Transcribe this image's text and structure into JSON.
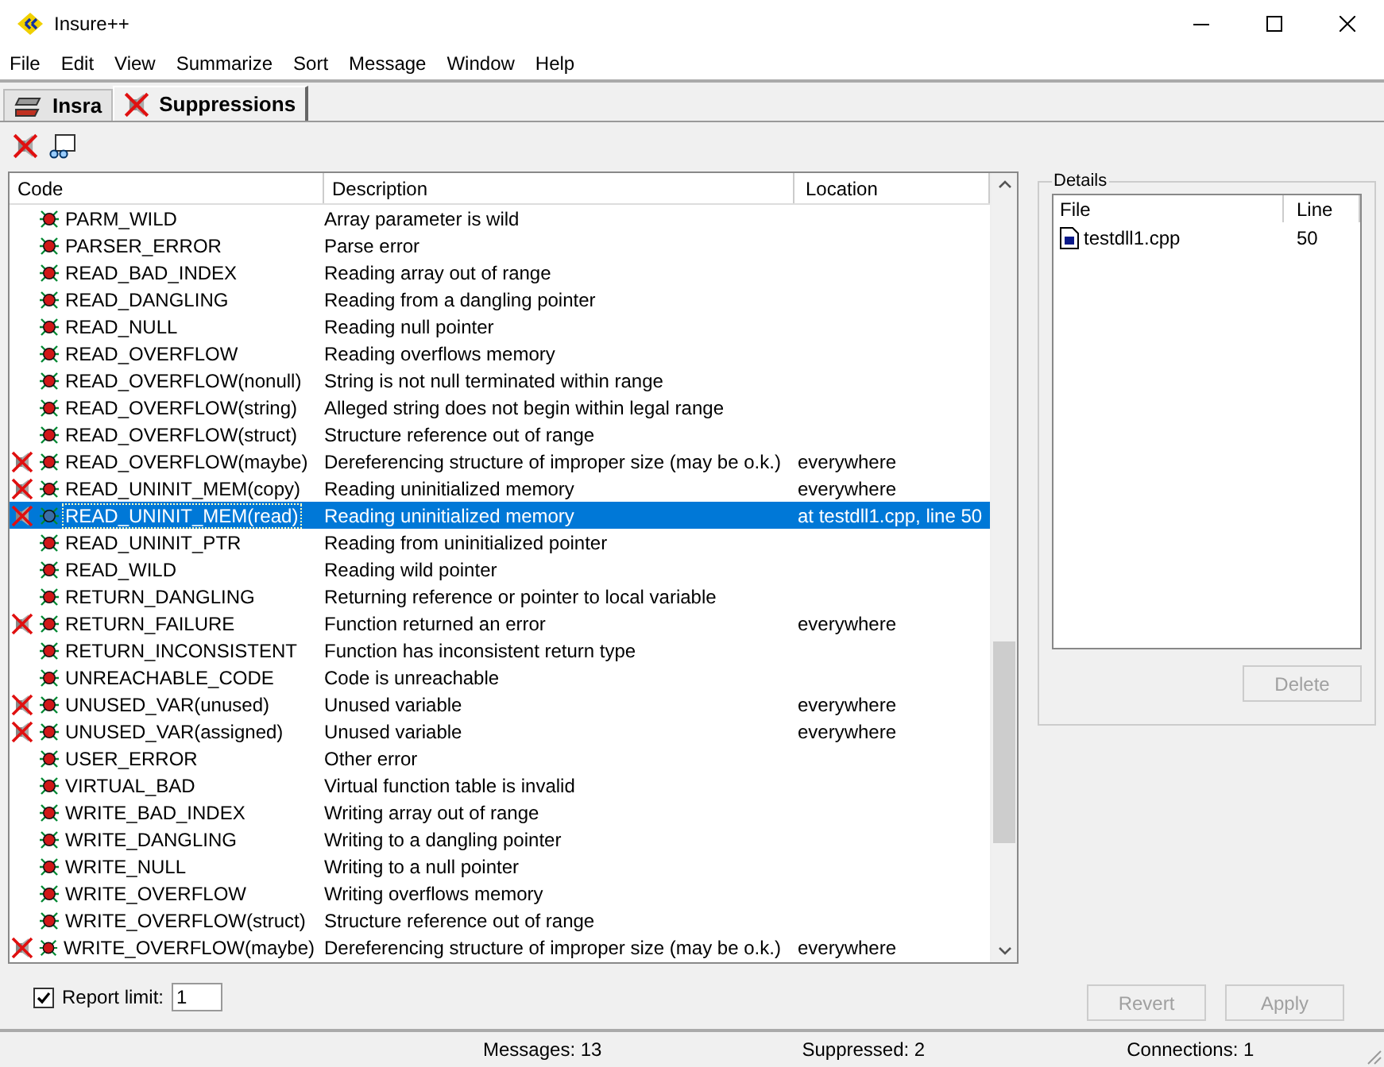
{
  "window": {
    "title": "Insure++"
  },
  "menu": [
    "File",
    "Edit",
    "View",
    "Summarize",
    "Sort",
    "Message",
    "Window",
    "Help"
  ],
  "tabs": [
    {
      "label": "Insra",
      "selected": false
    },
    {
      "label": "Suppressions",
      "selected": true
    }
  ],
  "table": {
    "columns": [
      "Code",
      "Description",
      "Location"
    ],
    "rows": [
      {
        "code": "PARM_WILD",
        "description": "Array parameter is wild",
        "location": "",
        "suppressed": false,
        "selected": false
      },
      {
        "code": "PARSER_ERROR",
        "description": "Parse error",
        "location": "",
        "suppressed": false,
        "selected": false
      },
      {
        "code": "READ_BAD_INDEX",
        "description": "Reading array out of range",
        "location": "",
        "suppressed": false,
        "selected": false
      },
      {
        "code": "READ_DANGLING",
        "description": "Reading from a dangling pointer",
        "location": "",
        "suppressed": false,
        "selected": false
      },
      {
        "code": "READ_NULL",
        "description": "Reading null pointer",
        "location": "",
        "suppressed": false,
        "selected": false
      },
      {
        "code": "READ_OVERFLOW",
        "description": "Reading overflows memory",
        "location": "",
        "suppressed": false,
        "selected": false
      },
      {
        "code": "READ_OVERFLOW(nonull)",
        "description": "String is not null terminated within range",
        "location": "",
        "suppressed": false,
        "selected": false
      },
      {
        "code": "READ_OVERFLOW(string)",
        "description": "Alleged string does not begin within legal range",
        "location": "",
        "suppressed": false,
        "selected": false
      },
      {
        "code": "READ_OVERFLOW(struct)",
        "description": "Structure reference out of range",
        "location": "",
        "suppressed": false,
        "selected": false
      },
      {
        "code": "READ_OVERFLOW(maybe)",
        "description": "Dereferencing structure of improper size (may be o.k.)",
        "location": "everywhere",
        "suppressed": true,
        "selected": false
      },
      {
        "code": "READ_UNINIT_MEM(copy)",
        "description": "Reading uninitialized memory",
        "location": "everywhere",
        "suppressed": true,
        "selected": false
      },
      {
        "code": "READ_UNINIT_MEM(read)",
        "description": "Reading uninitialized memory",
        "location": "at testdll1.cpp, line 50",
        "suppressed": true,
        "selected": true
      },
      {
        "code": "READ_UNINIT_PTR",
        "description": "Reading from uninitialized pointer",
        "location": "",
        "suppressed": false,
        "selected": false
      },
      {
        "code": "READ_WILD",
        "description": "Reading wild pointer",
        "location": "",
        "suppressed": false,
        "selected": false
      },
      {
        "code": "RETURN_DANGLING",
        "description": "Returning reference or pointer to local variable",
        "location": "",
        "suppressed": false,
        "selected": false
      },
      {
        "code": "RETURN_FAILURE",
        "description": "Function returned an error",
        "location": "everywhere",
        "suppressed": true,
        "selected": false
      },
      {
        "code": "RETURN_INCONSISTENT",
        "description": "Function has inconsistent return type",
        "location": "",
        "suppressed": false,
        "selected": false
      },
      {
        "code": "UNREACHABLE_CODE",
        "description": "Code is unreachable",
        "location": "",
        "suppressed": false,
        "selected": false
      },
      {
        "code": "UNUSED_VAR(unused)",
        "description": "Unused variable",
        "location": "everywhere",
        "suppressed": true,
        "selected": false
      },
      {
        "code": "UNUSED_VAR(assigned)",
        "description": "Unused variable",
        "location": "everywhere",
        "suppressed": true,
        "selected": false
      },
      {
        "code": "USER_ERROR",
        "description": "Other error",
        "location": "",
        "suppressed": false,
        "selected": false
      },
      {
        "code": "VIRTUAL_BAD",
        "description": "Virtual function table is invalid",
        "location": "",
        "suppressed": false,
        "selected": false
      },
      {
        "code": "WRITE_BAD_INDEX",
        "description": "Writing array out of range",
        "location": "",
        "suppressed": false,
        "selected": false
      },
      {
        "code": "WRITE_DANGLING",
        "description": "Writing to a dangling pointer",
        "location": "",
        "suppressed": false,
        "selected": false
      },
      {
        "code": "WRITE_NULL",
        "description": "Writing to a null pointer",
        "location": "",
        "suppressed": false,
        "selected": false
      },
      {
        "code": "WRITE_OVERFLOW",
        "description": "Writing overflows memory",
        "location": "",
        "suppressed": false,
        "selected": false
      },
      {
        "code": "WRITE_OVERFLOW(struct)",
        "description": "Structure reference out of range",
        "location": "",
        "suppressed": false,
        "selected": false
      },
      {
        "code": "WRITE_OVERFLOW(maybe)",
        "description": "Dereferencing structure of improper size (may be o.k.)",
        "location": "everywhere",
        "suppressed": true,
        "selected": false
      }
    ]
  },
  "details": {
    "title": "Details",
    "columns": [
      "File",
      "Line"
    ],
    "rows": [
      {
        "file": "testdll1.cpp",
        "line": "50"
      }
    ],
    "delete_button": {
      "label": "Delete",
      "disabled": true
    }
  },
  "report_limit": {
    "label": "Report limit:",
    "checked": true,
    "value": "1"
  },
  "buttons": [
    {
      "label": "Revert",
      "disabled": true
    },
    {
      "label": "Apply",
      "disabled": true
    }
  ],
  "status_bar": [
    "Messages: 13",
    "Suppressed: 2",
    "Connections: 1"
  ]
}
